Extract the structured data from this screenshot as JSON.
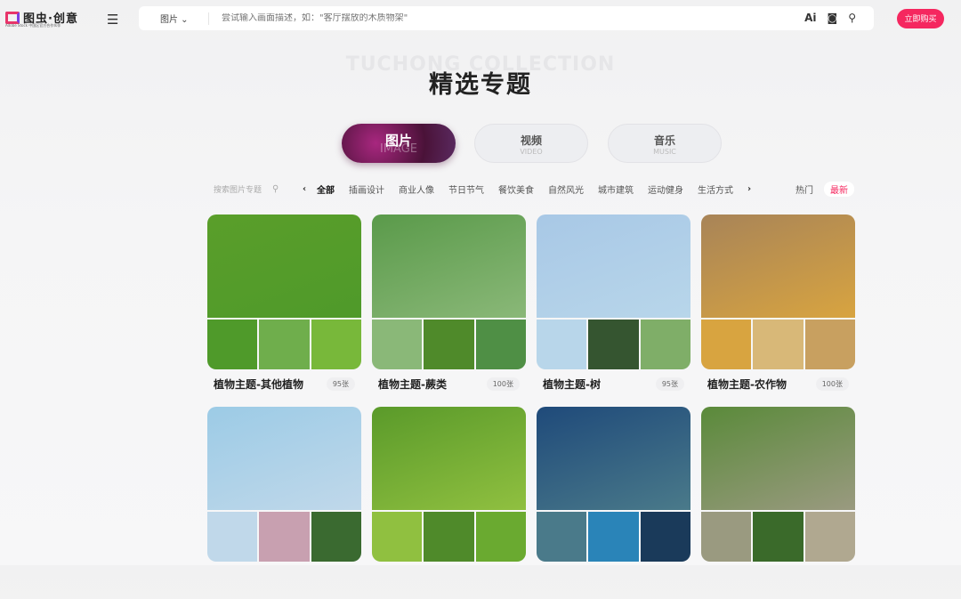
{
  "header": {
    "logo": "图虫·创意",
    "logo_sub": "Adobe Stock 中国区官方合作伙伴",
    "search_type": "图片",
    "search_placeholder": "尝试输入画面描述，如：\"客厅摆放的木质物架\"",
    "ai_label": "Ai",
    "buy_label": "立即购买"
  },
  "hero": {
    "bg_text": "TUCHONG COLLECTION",
    "title": "精选专题"
  },
  "tabs": [
    {
      "cn": "图片",
      "en": "IMAGE"
    },
    {
      "cn": "视频",
      "en": "VIDEO"
    },
    {
      "cn": "音乐",
      "en": "MUSIC"
    }
  ],
  "filter": {
    "search_placeholder": "搜索图片专题",
    "categories": [
      "全部",
      "插画设计",
      "商业人像",
      "节日节气",
      "餐饮美食",
      "自然风光",
      "城市建筑",
      "运动健身",
      "生活方式"
    ],
    "sort": [
      "热门",
      "最新"
    ]
  },
  "cards": [
    {
      "title": "植物主题-其他植物",
      "count": "95张",
      "colors": [
        "#5a9e2a",
        "#4f9a2a",
        "#6fae4c",
        "#78b83a"
      ]
    },
    {
      "title": "植物主题-蕨类",
      "count": "100张",
      "colors": [
        "#5a9a4a",
        "#8ab878",
        "#4f8a2a",
        "#4f8f45"
      ]
    },
    {
      "title": "植物主题-树",
      "count": "95张",
      "colors": [
        "#a8c8e6",
        "#b8d6ea",
        "#355530",
        "#7fae68"
      ]
    },
    {
      "title": "植物主题-农作物",
      "count": "100张",
      "colors": [
        "#a88458",
        "#d8a440",
        "#d8b878",
        "#c8a060"
      ]
    },
    {
      "title": "",
      "count": "",
      "colors": [
        "#9ccbe6",
        "#c0d8ea",
        "#c8a0b0",
        "#3a6a30"
      ]
    },
    {
      "title": "",
      "count": "",
      "colors": [
        "#5a9a2a",
        "#90c040",
        "#4f8a2a",
        "#6aaa30"
      ]
    },
    {
      "title": "",
      "count": "",
      "colors": [
        "#1f4a7a",
        "#4a7a8a",
        "#2a84b8",
        "#1a3a5a"
      ]
    },
    {
      "title": "",
      "count": "",
      "colors": [
        "#5a8a3a",
        "#9a9a80",
        "#3a6a2a",
        "#b0a890"
      ]
    }
  ]
}
